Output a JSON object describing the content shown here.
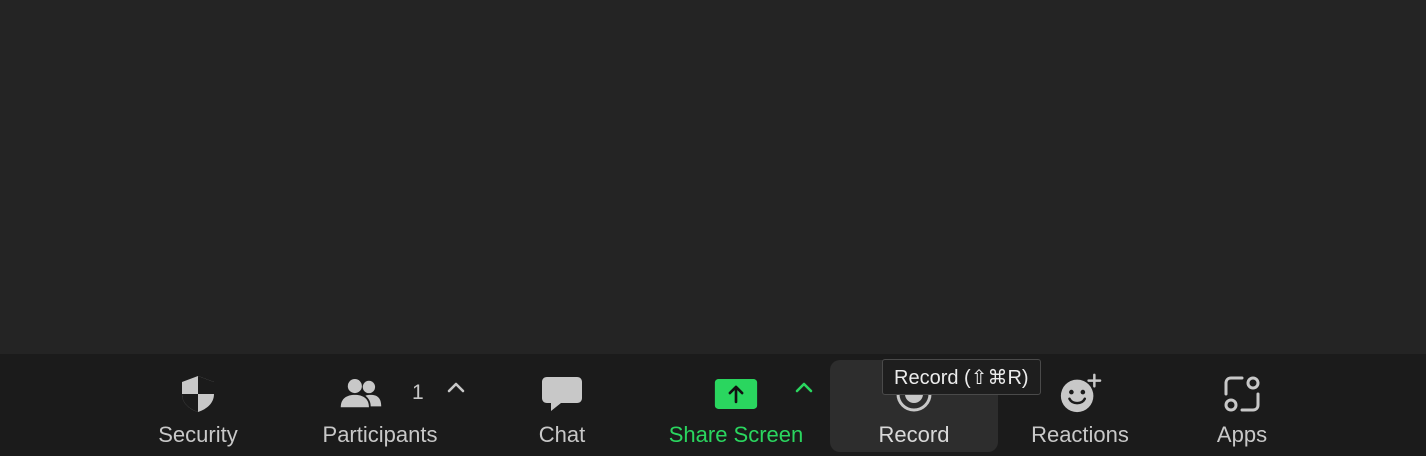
{
  "toolbar": {
    "security": {
      "label": "Security",
      "icon": "shield-icon"
    },
    "participants": {
      "label": "Participants",
      "count": "1",
      "icon": "people-icon"
    },
    "chat": {
      "label": "Chat",
      "icon": "speech-bubble-icon"
    },
    "share_screen": {
      "label": "Share Screen",
      "icon": "share-arrow-icon",
      "color": "#2ad65f"
    },
    "record": {
      "label": "Record",
      "icon": "record-icon",
      "tooltip": "Record (⇧⌘R)"
    },
    "reactions": {
      "label": "Reactions",
      "icon": "smiley-plus-icon"
    },
    "apps": {
      "label": "Apps",
      "icon": "apps-icon"
    }
  },
  "colors": {
    "background": "#242424",
    "toolbar": "#1b1b1b",
    "accent_green": "#2ad65f",
    "text": "#c8c8c8"
  }
}
